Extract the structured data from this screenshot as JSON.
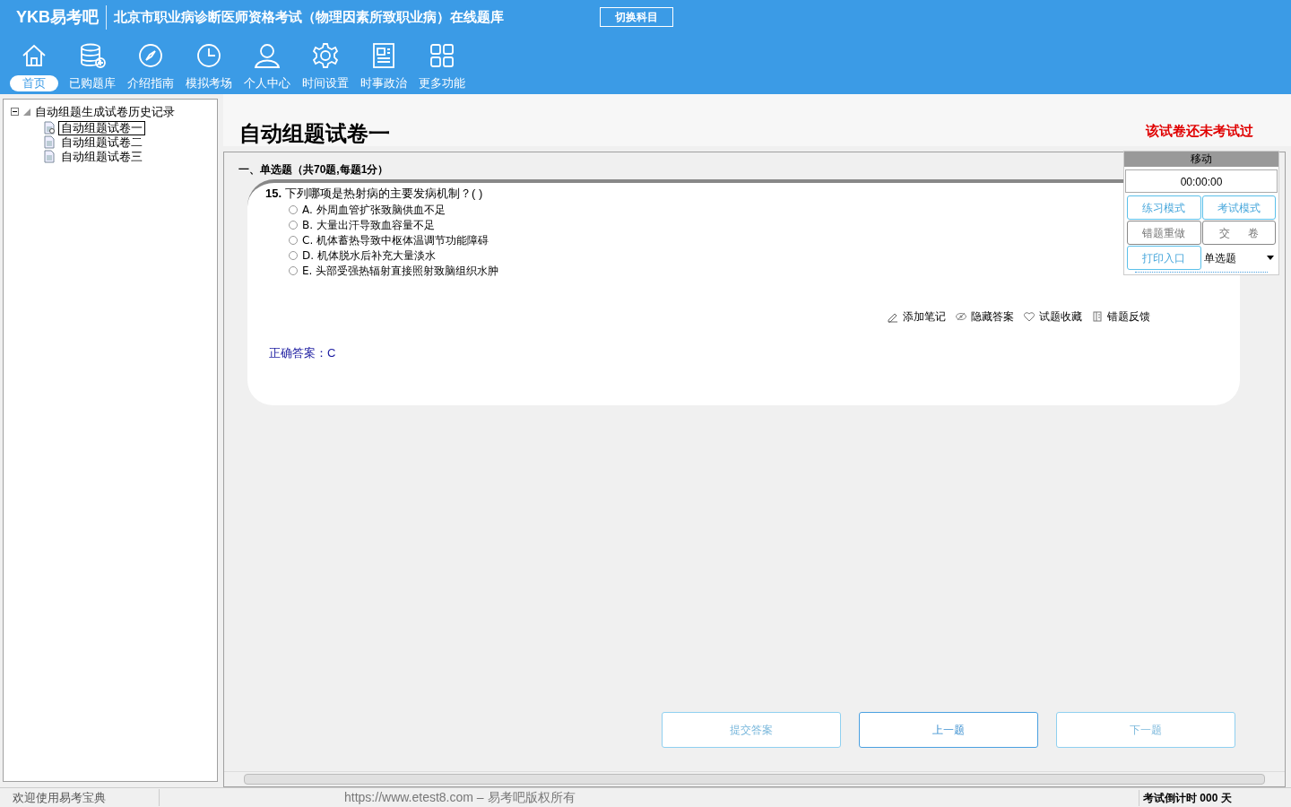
{
  "header": {
    "logo": "YKB易考吧",
    "title": "北京市职业病诊断医师资格考试（物理因素所致职业病）在线题库",
    "switch_button": "切换科目"
  },
  "nav": [
    {
      "label": "首页",
      "selected": true
    },
    {
      "label": "已购题库",
      "selected": false
    },
    {
      "label": "介绍指南",
      "selected": false
    },
    {
      "label": "模拟考场",
      "selected": false
    },
    {
      "label": "个人中心",
      "selected": false
    },
    {
      "label": "时间设置",
      "selected": false
    },
    {
      "label": "时事政治",
      "selected": false
    },
    {
      "label": "更多功能",
      "selected": false
    }
  ],
  "tree": {
    "label": "自动组题生成试卷历史记录",
    "expanded": true,
    "children": [
      {
        "label": "自动组题试卷一",
        "selected": true
      },
      {
        "label": "自动组题试卷二",
        "selected": false
      },
      {
        "label": "自动组题试卷三",
        "selected": false
      }
    ]
  },
  "paper": {
    "title": "自动组题试卷一",
    "status": "该试卷还未考试过"
  },
  "section": "一、单选题（共70题,每题1分）",
  "question": {
    "number": "15.",
    "text": "下列哪项是热射病的主要发病机制？( )",
    "options": [
      {
        "label": "A.",
        "text": "外周血管扩张致脑供血不足",
        "selected": false
      },
      {
        "label": "B.",
        "text": "大量出汗导致血容量不足",
        "selected": false
      },
      {
        "label": "C.",
        "text": "机体蓄热导致中枢体温调节功能障碍",
        "selected": false
      },
      {
        "label": "D.",
        "text": "机体脱水后补充大量淡水",
        "selected": false
      },
      {
        "label": "E.",
        "text": "头部受强热辐射直接照射致脑组织水肿",
        "selected": false
      }
    ]
  },
  "actions": [
    "添加笔记",
    "隐藏答案",
    "试题收藏",
    "错题反馈"
  ],
  "answer": "正确答案：C",
  "control_panel": {
    "title": "移动",
    "timer": "00:00:00",
    "buttons": [
      {
        "label": "练习模式",
        "kind": "blue"
      },
      {
        "label": "考试模式",
        "kind": "blue"
      },
      {
        "label": "错题重做",
        "kind": "grey"
      },
      {
        "label": "交      卷",
        "kind": "grey"
      },
      {
        "label": "打印入口",
        "kind": "blue"
      }
    ],
    "type_select": "单选题"
  },
  "bottom_buttons": [
    {
      "label": "提交答案",
      "kind": "light"
    },
    {
      "label": "上一题",
      "kind": "strong"
    },
    {
      "label": "下一题",
      "kind": "light"
    }
  ],
  "status_bar": {
    "left": "欢迎使用易考宝典",
    "center": "https://www.etest8.com – 易考吧版权所有",
    "right": "考试倒计时 000 天"
  }
}
